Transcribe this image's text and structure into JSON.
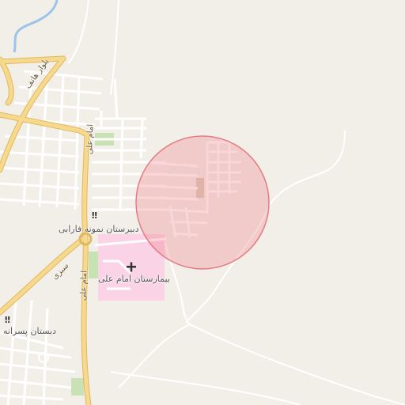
{
  "map": {
    "colors": {
      "background": "#f2efe9",
      "major_road": "#f6d98c",
      "major_road_casing": "#e0b860",
      "minor_road": "#ffffff",
      "minor_road_casing": "#d9d4cc",
      "water": "#9cc3ea",
      "hospital_area": "#fbd3e6",
      "park": "#c8e2b5",
      "highlight_circle_fill": "rgba(240,120,130,0.30)",
      "highlight_circle_stroke": "#e57b85"
    },
    "labels": {
      "school_1": "دبیرستان نمونه فارابی",
      "hospital": "بیمارستان امام علی",
      "school_2": "دبستان پسرانه",
      "road_hatef": "بلوار هاتف",
      "road_imam_ali_1": "امام علی",
      "road_imam_ali_2": "امام علی",
      "road_sabzi": "سبزی"
    },
    "icons": {
      "school_1": "school-icon",
      "hospital": "hospital-cross-icon",
      "school_2": "school-icon"
    }
  }
}
